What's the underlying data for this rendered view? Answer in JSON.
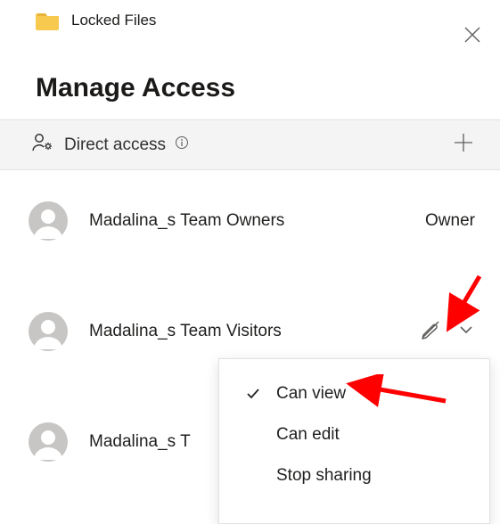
{
  "header": {
    "location_title": "Locked Files"
  },
  "page": {
    "title": "Manage Access"
  },
  "section": {
    "label": "Direct access"
  },
  "principals": [
    {
      "name": "Madalina_s Team Owners",
      "role": "Owner"
    },
    {
      "name": "Madalina_s Team Visitors",
      "role": ""
    },
    {
      "name": "Madalina_s T",
      "role": ""
    }
  ],
  "dropdown": {
    "items": [
      {
        "label": "Can view",
        "selected": true
      },
      {
        "label": "Can edit",
        "selected": false
      },
      {
        "label": "Stop sharing",
        "selected": false
      }
    ]
  },
  "colors": {
    "annotation": "#ff0000",
    "section_bg": "#f4f4f4"
  }
}
